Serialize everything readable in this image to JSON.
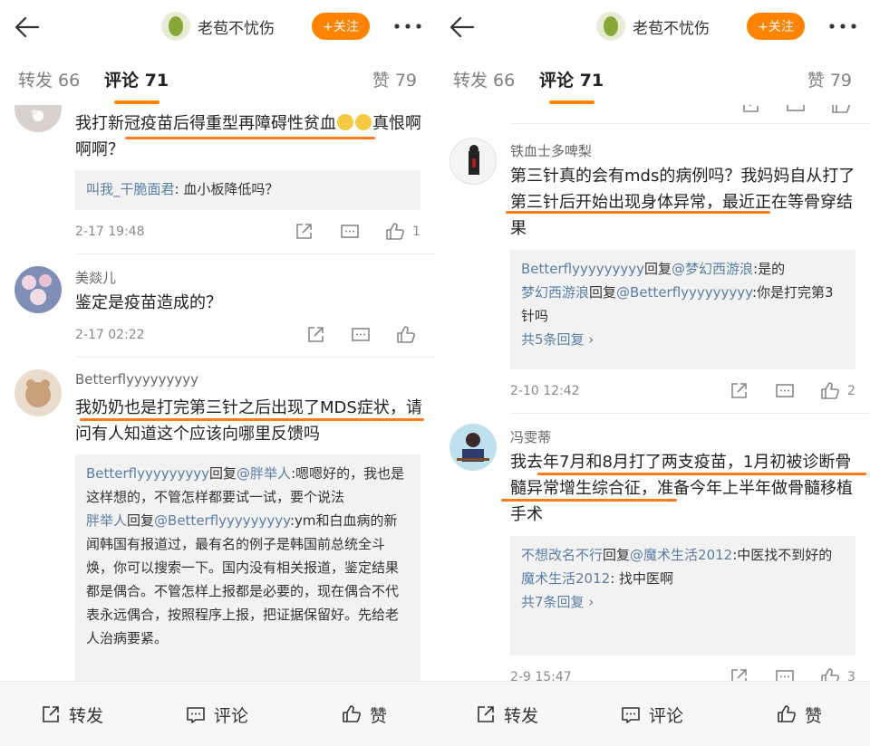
{
  "left": {
    "header": {
      "username": "老苞不忧伤",
      "follow_label": "+关注"
    },
    "tabs": {
      "repost": "转发 66",
      "comments": "评论 71",
      "likes": "赞 79"
    },
    "comments": [
      {
        "text": "我打新冠疫苗后得重型再障碍性贫血",
        "text_tail": "真恨啊啊啊？",
        "reply": {
          "user": "叫我_干脆面君",
          "text": ": 血小板降低吗？"
        },
        "time": "2-17 19:48",
        "like_count": "1"
      },
      {
        "name": "美燚儿",
        "text": "鉴定是疫苗造成的？",
        "time": "2-17 02:22",
        "like_count": ""
      },
      {
        "name": "Betterflyyyyyyyyy",
        "text": "我奶奶也是打完第三针之后出现了MDS症状，请问有人知道这个应该向哪里反馈吗",
        "replies": [
          {
            "user": "Betterflyyyyyyyyy",
            "mid": "回复",
            "target": "@胖举人",
            "text": ":嗯嗯好的，我也是这样想的，不管怎样都要试一试，要个说法"
          },
          {
            "user": "胖举人",
            "mid": "回复",
            "target": "@Betterflyyyyyyyyy",
            "text": ":ym和白血病的新闻韩国有报道过，最有名的例子是韩国前总统全斗焕，你可以搜索一下。国内没有相关报道，鉴定结果都是偶合。不管怎样上报都是必要的，现在偶合不代表永远偶合，按照程序上报，把证据保留好。先给老人治病要紧。"
          }
        ]
      }
    ],
    "bottom": {
      "repost": "转发",
      "comment": "评论",
      "like": "赞"
    }
  },
  "right": {
    "header": {
      "username": "老苞不忧伤",
      "follow_label": "+关注"
    },
    "tabs": {
      "repost": "转发 66",
      "comments": "评论 71",
      "likes": "赞 79"
    },
    "comments": [
      {
        "name": "铁血士多啤梨",
        "text": "第三针真的会有mds的病例吗？我妈妈自从打了第三针后开始出现身体异常，最近正在等骨穿结果",
        "replies": [
          {
            "user": "Betterflyyyyyyyyy",
            "mid": "回复",
            "target": "@梦幻西游浪",
            "text": ":是的"
          },
          {
            "user": "梦幻西游浪",
            "mid": "回复",
            "target": "@Betterflyyyyyyyyy",
            "text": ":你是打完第3针吗"
          }
        ],
        "more_replies": "共5条回复 ›",
        "time": "2-10 12:42",
        "like_count": "2"
      },
      {
        "name": "冯雯蒂",
        "text": "我去年7月和8月打了两支疫苗，1月初被诊断骨髓异常增生综合征，准备今年上半年做骨髓移植手术",
        "replies": [
          {
            "user": "不想改名不行",
            "mid": "回复",
            "target": "@魔术生活2012",
            "text": ":中医找不到好的"
          },
          {
            "user": "魔术生活2012",
            "mid": "",
            "target": "",
            "text": ": 找中医啊"
          }
        ],
        "more_replies": "共7条回复 ›",
        "time": "2-9 15:47",
        "like_count": "3"
      }
    ],
    "bottom": {
      "repost": "转发",
      "comment": "评论",
      "like": "赞"
    }
  },
  "colors": {
    "accent": "#ff8200",
    "link": "#5b7ea5",
    "highlight": "#ff7a1a"
  },
  "icons": [
    "back-arrow-icon",
    "more-dots-icon",
    "share-icon",
    "comment-icon",
    "thumbs-up-icon"
  ]
}
